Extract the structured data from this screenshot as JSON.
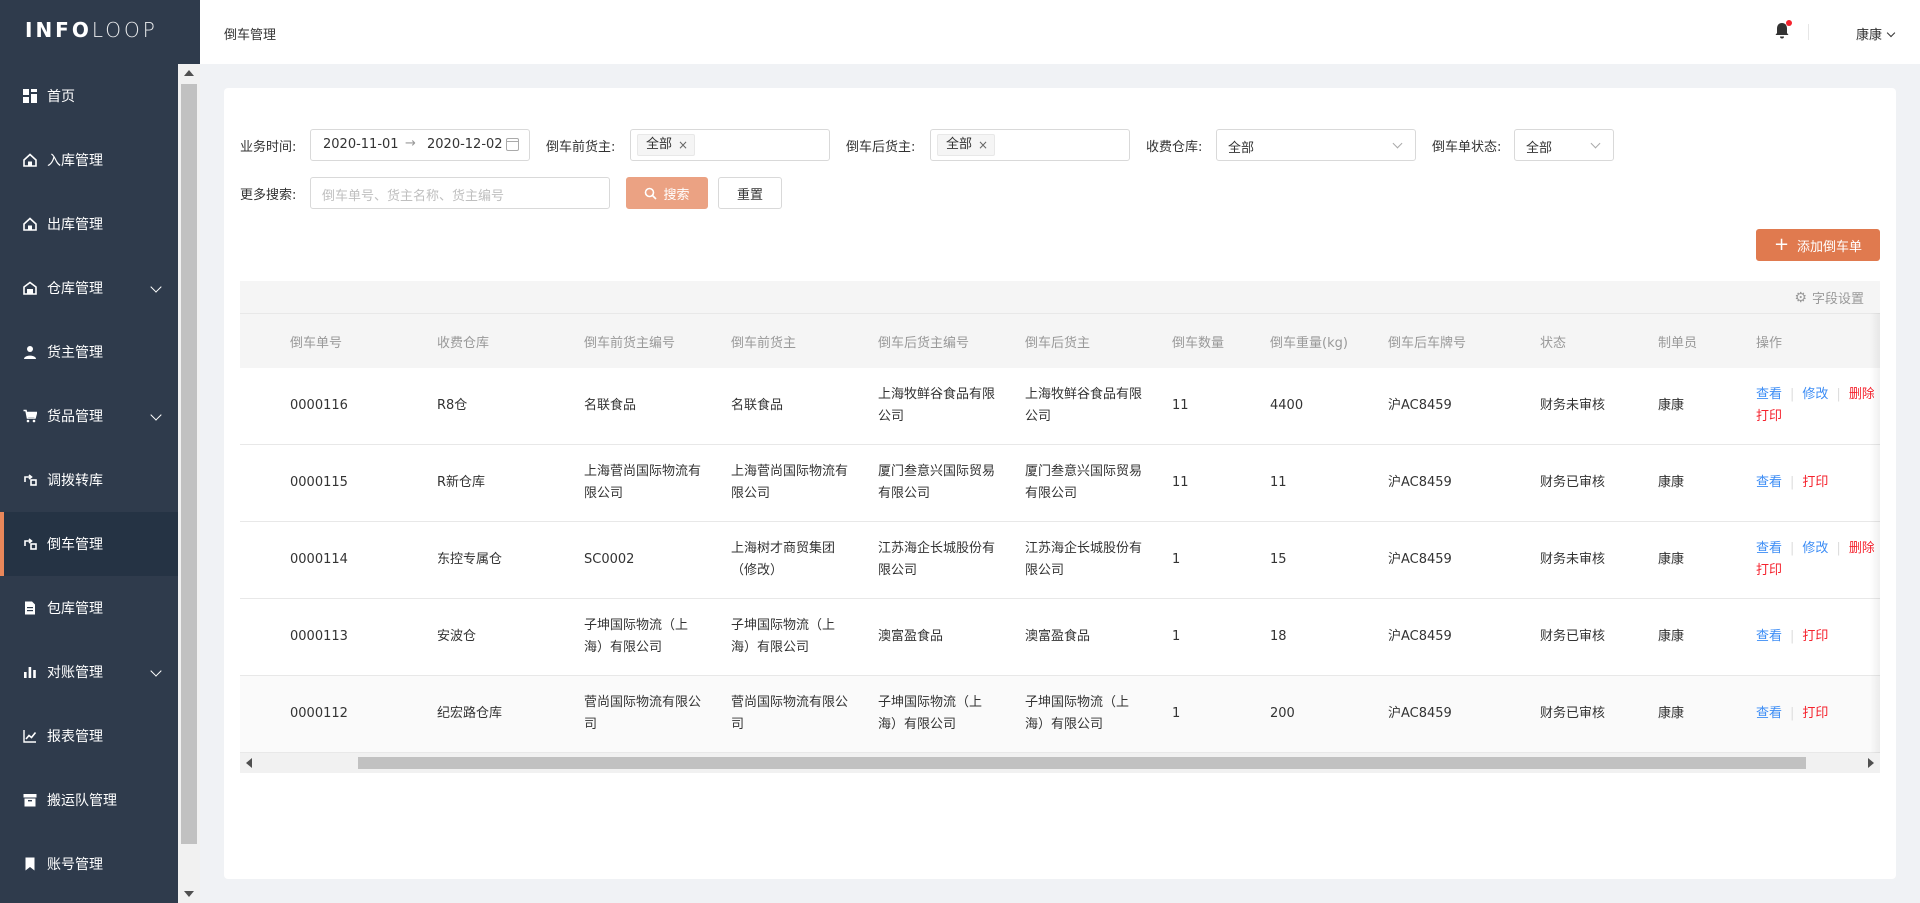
{
  "app": {
    "logo_bold": "INFO",
    "logo_light": "LOOP"
  },
  "sidebar": {
    "items": [
      {
        "label": "首页",
        "icon": "dashboard-icon",
        "expandable": false,
        "active": false
      },
      {
        "label": "入库管理",
        "icon": "home-in-icon",
        "expandable": false,
        "active": false
      },
      {
        "label": "出库管理",
        "icon": "home-out-icon",
        "expandable": false,
        "active": false
      },
      {
        "label": "仓库管理",
        "icon": "warehouse-icon",
        "expandable": true,
        "active": false
      },
      {
        "label": "货主管理",
        "icon": "user-icon",
        "expandable": false,
        "active": false
      },
      {
        "label": "货品管理",
        "icon": "cart-icon",
        "expandable": true,
        "active": false
      },
      {
        "label": "调拨转库",
        "icon": "transfer-icon",
        "expandable": false,
        "active": false
      },
      {
        "label": "倒车管理",
        "icon": "swap-icon",
        "expandable": false,
        "active": true
      },
      {
        "label": "包库管理",
        "icon": "file-icon",
        "expandable": false,
        "active": false
      },
      {
        "label": "对账管理",
        "icon": "bar-chart-icon",
        "expandable": true,
        "active": false
      },
      {
        "label": "报表管理",
        "icon": "line-chart-icon",
        "expandable": false,
        "active": false
      },
      {
        "label": "搬运队管理",
        "icon": "box-icon",
        "expandable": false,
        "active": false
      },
      {
        "label": "账号管理",
        "icon": "bookmark-icon",
        "expandable": false,
        "active": false
      }
    ],
    "accent_color": "#e9875a"
  },
  "header": {
    "breadcrumb": "倒车管理",
    "user_name": "康康"
  },
  "filters": {
    "business_time_label": "业务时间:",
    "date_start": "2020-11-01",
    "date_arrow": "→",
    "date_end": "2020-12-02",
    "before_owner_label": "倒车前货主:",
    "before_owner_tag": "全部",
    "after_owner_label": "倒车后货主:",
    "after_owner_tag": "全部",
    "warehouse_label": "收费仓库:",
    "warehouse_value": "全部",
    "status_label": "倒车单状态:",
    "status_value": "全部",
    "more_label": "更多搜索:",
    "more_placeholder": "倒车单号、货主名称、货主编号",
    "search_btn": "搜索",
    "reset_btn": "重置",
    "add_btn": "添加倒车单",
    "tag_close": "×"
  },
  "table": {
    "field_settings": "字段设置",
    "columns": [
      "倒车单号",
      "收费仓库",
      "倒车前货主编号",
      "倒车前货主",
      "倒车后货主编号",
      "倒车后货主",
      "倒车数量",
      "倒车重量(kg)",
      "倒车后车牌号",
      "状态",
      "制单员",
      "操作"
    ],
    "action_labels": {
      "view": "查看",
      "edit": "修改",
      "delete": "删除",
      "print": "打印"
    },
    "rows": [
      {
        "id": "0000116",
        "warehouse": "R8仓",
        "before_code": "名联食品",
        "before_owner": "名联食品",
        "after_code": "上海牧鲜谷食品有限公司",
        "after_owner": "上海牧鲜谷食品有限公司",
        "qty": "11",
        "weight": "4400",
        "plate": "沪AC8459",
        "status": "财务未审核",
        "creator": "康康",
        "editable": true
      },
      {
        "id": "0000115",
        "warehouse": "R新仓库",
        "before_code": "上海菅尚国际物流有限公司",
        "before_owner": "上海菅尚国际物流有限公司",
        "after_code": "厦门叁意兴国际贸易有限公司",
        "after_owner": "厦门叁意兴国际贸易有限公司",
        "qty": "11",
        "weight": "11",
        "plate": "沪AC8459",
        "status": "财务已审核",
        "creator": "康康",
        "editable": false
      },
      {
        "id": "0000114",
        "warehouse": "东控专属仓",
        "before_code": "SC0002",
        "before_owner": "上海树才商贸集团（修改）",
        "after_code": "江苏海企长城股份有限公司",
        "after_owner": "江苏海企长城股份有限公司",
        "qty": "1",
        "weight": "15",
        "plate": "沪AC8459",
        "status": "财务未审核",
        "creator": "康康",
        "editable": true
      },
      {
        "id": "0000113",
        "warehouse": "安波仓",
        "before_code": "子坤国际物流（上海）有限公司",
        "before_owner": "子坤国际物流（上海）有限公司",
        "after_code": "澳富盈食品",
        "after_owner": "澳富盈食品",
        "qty": "1",
        "weight": "18",
        "plate": "沪AC8459",
        "status": "财务已审核",
        "creator": "康康",
        "editable": false
      },
      {
        "id": "0000112",
        "warehouse": "纪宏路仓库",
        "before_code": "菅尚国际物流有限公司",
        "before_owner": "菅尚国际物流有限公司",
        "after_code": "子坤国际物流（上海）有限公司",
        "after_owner": "子坤国际物流（上海）有限公司",
        "qty": "1",
        "weight": "200",
        "plate": "沪AC8459",
        "status": "财务已审核",
        "creator": "康康",
        "editable": false
      }
    ]
  }
}
